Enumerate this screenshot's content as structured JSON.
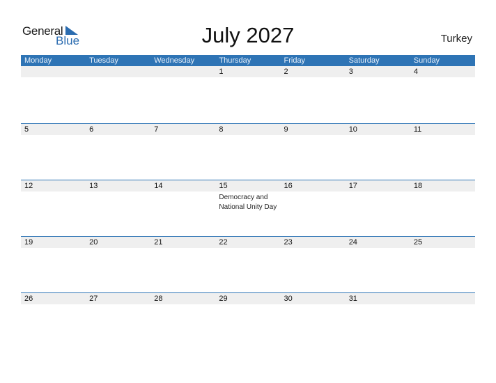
{
  "logo": {
    "line1": "General",
    "line2": "Blue",
    "icon": "triangle-flag-icon"
  },
  "title": "July 2027",
  "country": "Turkey",
  "colors": {
    "accent": "#2e74b5",
    "strip": "#efefef"
  },
  "weekdays": [
    "Monday",
    "Tuesday",
    "Wednesday",
    "Thursday",
    "Friday",
    "Saturday",
    "Sunday"
  ],
  "weeks": [
    [
      "",
      "",
      "",
      "1",
      "2",
      "3",
      "4"
    ],
    [
      "5",
      "6",
      "7",
      "8",
      "9",
      "10",
      "11"
    ],
    [
      "12",
      "13",
      "14",
      "15",
      "16",
      "17",
      "18"
    ],
    [
      "19",
      "20",
      "21",
      "22",
      "23",
      "24",
      "25"
    ],
    [
      "26",
      "27",
      "28",
      "29",
      "30",
      "31",
      ""
    ]
  ],
  "events": {
    "2.3": "Democracy and National Unity Day"
  }
}
